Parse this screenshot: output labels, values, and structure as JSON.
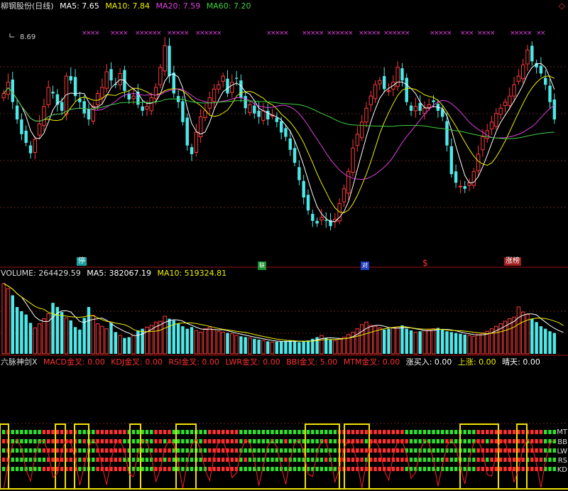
{
  "header": {
    "stock_name": "柳钢股份(日线)",
    "ma5_label": "MA5: 7.65",
    "ma10_label": "MA10: 7.84",
    "ma20_label": "MA20: 7.59",
    "ma60_label": "MA60: 7.20",
    "high_price_label": "8.69",
    "colors": {
      "ma5": "#ffffff",
      "ma10": "#f0f000",
      "ma20": "#e040e0",
      "ma60": "#40d040"
    }
  },
  "markers": {
    "stop": "停",
    "green": "联",
    "blue": "对",
    "dollar": "$",
    "limit_list": "涨榜"
  },
  "volume_header": {
    "title": "VOLUME: 264429.59",
    "ma5": "MA5: 382067.19",
    "ma10": "MA10: 519324.81"
  },
  "indicator_header": {
    "name": "六脉神剑X",
    "macd": "MACD金叉: 0.00",
    "kdj": "KDJ金叉: 0.00",
    "rsi": "RSI金叉: 0.00",
    "lwr": "LWR金叉: 0.00",
    "bbi": "BBI金叉: 5.00",
    "mtm": "MTM金叉: 0.00",
    "buy": "涨买入: 0.00",
    "up": "上涨: 0.00",
    "sunny": "晴天: 0.00"
  },
  "indicator_rows": [
    "MT",
    "BB",
    "LW",
    "RS",
    "KD"
  ],
  "chart_data": {
    "type": "candlestick",
    "price_ylim": [
      6.3,
      8.8
    ],
    "highest_marked": 8.69,
    "ma_latest": {
      "MA5": 7.65,
      "MA10": 7.84,
      "MA20": 7.59,
      "MA60": 7.2
    },
    "volume_latest": 264429.59,
    "volume_ma_latest": {
      "MA5": 382067.19,
      "MA10": 519324.81
    },
    "indicator_values": {
      "MACD金叉": 0,
      "KDJ金叉": 0,
      "RSI金叉": 0,
      "LWR金叉": 0,
      "BBI金叉": 5,
      "MTM金叉": 0,
      "涨买入": 0,
      "上涨": 0,
      "晴天": 0
    },
    "closes": [
      8.05,
      8.18,
      7.95,
      7.75,
      7.58,
      7.48,
      7.36,
      7.52,
      7.7,
      7.9,
      8.12,
      8.05,
      7.92,
      7.85,
      8.25,
      8.2,
      8.02,
      7.95,
      7.82,
      7.75,
      7.9,
      8.05,
      8.12,
      8.3,
      8.2,
      8.15,
      8.28,
      8.08,
      7.98,
      8.02,
      7.92,
      7.85,
      7.9,
      8.0,
      8.12,
      8.35,
      8.6,
      8.25,
      8.05,
      7.95,
      7.72,
      7.45,
      7.35,
      7.6,
      7.78,
      7.85,
      8.0,
      8.1,
      8.15,
      8.25,
      8.05,
      8.18,
      8.22,
      8.0,
      7.88,
      7.92,
      7.82,
      7.78,
      7.85,
      7.75,
      7.8,
      7.72,
      7.6,
      7.55,
      7.4,
      7.25,
      7.05,
      6.85,
      6.7,
      6.58,
      6.55,
      6.62,
      6.58,
      6.52,
      6.6,
      6.78,
      6.95,
      7.15,
      7.42,
      7.58,
      7.72,
      7.88,
      8.02,
      8.15,
      8.2,
      8.1,
      8.08,
      8.18,
      8.35,
      8.2,
      7.95,
      7.85,
      7.9,
      7.85,
      7.88,
      7.92,
      7.95,
      7.85,
      7.78,
      7.45,
      7.12,
      7.02,
      6.98,
      6.95,
      7.02,
      7.15,
      7.35,
      7.55,
      7.62,
      7.72,
      7.82,
      7.88,
      7.95,
      8.02,
      8.15,
      8.25,
      8.38,
      8.55,
      8.42,
      8.35,
      8.28,
      8.15,
      7.95,
      7.75
    ],
    "volumes": [
      840,
      780,
      700,
      560,
      510,
      470,
      370,
      310,
      360,
      420,
      480,
      610,
      560,
      500,
      430,
      400,
      320,
      290,
      430,
      560,
      460,
      360,
      330,
      300,
      370,
      260,
      220,
      190,
      200,
      220,
      280,
      300,
      320,
      340,
      380,
      390,
      450,
      420,
      400,
      360,
      330,
      300,
      320,
      280,
      260,
      300,
      320,
      290,
      270,
      260,
      250,
      240,
      220,
      210,
      200,
      190,
      180,
      170,
      160,
      150,
      140,
      145,
      150,
      155,
      160,
      150,
      140,
      150,
      160,
      180,
      200,
      220,
      190,
      170,
      160,
      180,
      200,
      230,
      260,
      300,
      350,
      380,
      340,
      330,
      310,
      290,
      300,
      310,
      320,
      340,
      300,
      280,
      260,
      270,
      280,
      290,
      300,
      310,
      290,
      270,
      260,
      250,
      240,
      230,
      220,
      210,
      230,
      250,
      270,
      300,
      330,
      360,
      390,
      420,
      440,
      560,
      500,
      470,
      420,
      380,
      330,
      300,
      270,
      250,
      240,
      230
    ]
  }
}
